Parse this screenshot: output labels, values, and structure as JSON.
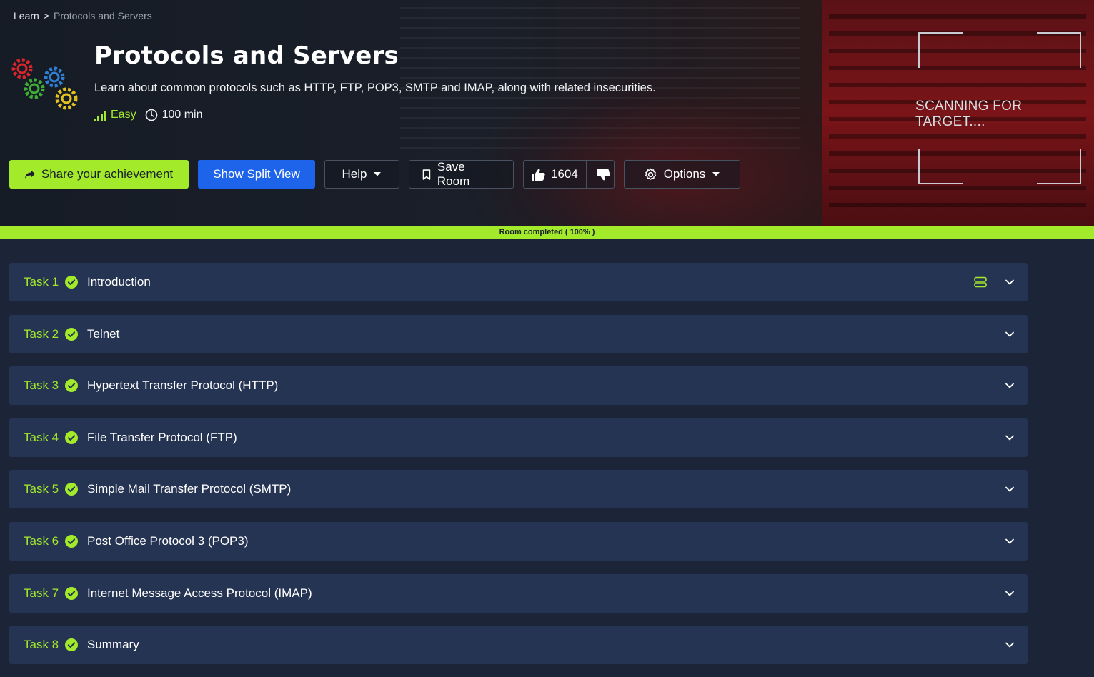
{
  "breadcrumb": {
    "root": "Learn",
    "separator": ">",
    "current": "Protocols and Servers"
  },
  "room": {
    "title": "Protocols and Servers",
    "description": "Learn about common protocols such as HTTP, FTP, POP3, SMTP and IMAP, along with related insecurities.",
    "difficulty": "Easy",
    "duration": "100 min"
  },
  "actions": {
    "share": "Share your achievement",
    "split": "Show Split View",
    "help": "Help",
    "save": "Save Room",
    "likes": "1604",
    "options": "Options"
  },
  "banner": {
    "scan_text": "SCANNING FOR TARGET...."
  },
  "progress": {
    "label": "Room completed ( 100% )",
    "value": 100
  },
  "tasks": [
    {
      "num": "Task 1",
      "title": "Introduction"
    },
    {
      "num": "Task 2",
      "title": "Telnet"
    },
    {
      "num": "Task 3",
      "title": "Hypertext Transfer Protocol (HTTP)"
    },
    {
      "num": "Task 4",
      "title": "File Transfer Protocol (FTP)"
    },
    {
      "num": "Task 5",
      "title": "Simple Mail Transfer Protocol (SMTP)"
    },
    {
      "num": "Task 6",
      "title": "Post Office Protocol 3 (POP3)"
    },
    {
      "num": "Task 7",
      "title": "Internet Message Access Protocol (IMAP)"
    },
    {
      "num": "Task 8",
      "title": "Summary"
    }
  ],
  "colors": {
    "accent": "#a3ea2a",
    "primary": "#1d64ea",
    "task_bg": "#263453",
    "page_bg": "#1c2538"
  },
  "icons": [
    "share-icon",
    "chevron-down-icon",
    "bookmark-icon",
    "thumbs-up-icon",
    "thumbs-down-icon",
    "gear-icon",
    "clock-icon",
    "signal-icon",
    "check-circle-icon",
    "server-icon",
    "gears-logo"
  ]
}
